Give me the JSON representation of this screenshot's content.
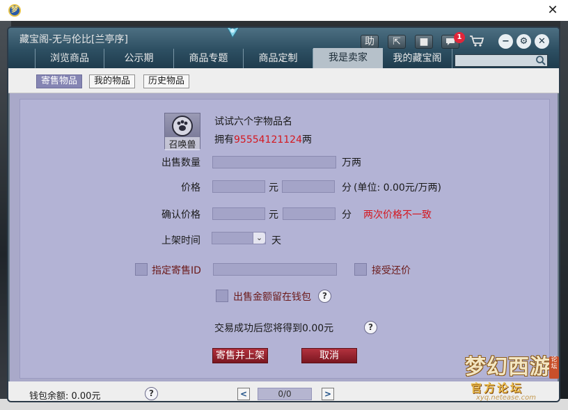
{
  "host": {
    "app_icon_text": "梦",
    "close_label": "✕"
  },
  "dialog": {
    "title": "藏宝阁-无与伦比[兰亭序]",
    "header_buttons": {
      "help_label": "助",
      "pin_label": "⇱",
      "record_label": "■",
      "message_badge": "1",
      "cart_label": "🛒",
      "minimize_label": "−",
      "settings_label": "⚙",
      "close_label": "✕"
    },
    "tabs": [
      {
        "label": "浏览商品"
      },
      {
        "label": "公示期"
      },
      {
        "label": "商品专题"
      },
      {
        "label": "商品定制"
      },
      {
        "label": "我是卖家"
      },
      {
        "label": "我的藏宝阁"
      }
    ],
    "search": {
      "value": "",
      "placeholder": ""
    },
    "subtabs": [
      {
        "label": "寄售物品"
      },
      {
        "label": "我的物品"
      },
      {
        "label": "历史物品"
      }
    ]
  },
  "item": {
    "icon_caption": "召唤兽",
    "name": "试试六个字物品名",
    "owned_prefix": "拥有",
    "owned_amount": "95554121124",
    "owned_suffix": "两"
  },
  "form": {
    "quantity_label": "出售数量",
    "quantity_value": "",
    "quantity_unit": "万两",
    "price_label": "价格",
    "price_yuan_value": "",
    "price_fen_value": "",
    "yuan_unit": "元",
    "fen_unit": "分",
    "unit_hint": "(单位: 0.00元/万两)",
    "confirm_label": "确认价格",
    "confirm_yuan_value": "",
    "confirm_fen_value": "",
    "mismatch_warning": "两次价格不一致",
    "shelf_time_label": "上架时间",
    "shelf_time_value": "",
    "shelf_time_unit": "天",
    "designate_label": "指定寄售ID",
    "designate_value": "",
    "accept_bargain_label": "接受还价",
    "keep_in_wallet_label": "出售金额留在钱包",
    "result_text": "交易成功后您将得到0.00元",
    "help_mark": "?"
  },
  "actions": {
    "submit_label": "寄售并上架",
    "cancel_label": "取消"
  },
  "footer": {
    "wallet_text": "钱包余额: 0.00元",
    "page_text": "0/0",
    "prev_label": "<",
    "next_label": ">"
  },
  "watermark": {
    "title": "梦幻西游",
    "subtitle": "官方论坛",
    "url": "xyq.netease.com",
    "tag": "论坛"
  }
}
